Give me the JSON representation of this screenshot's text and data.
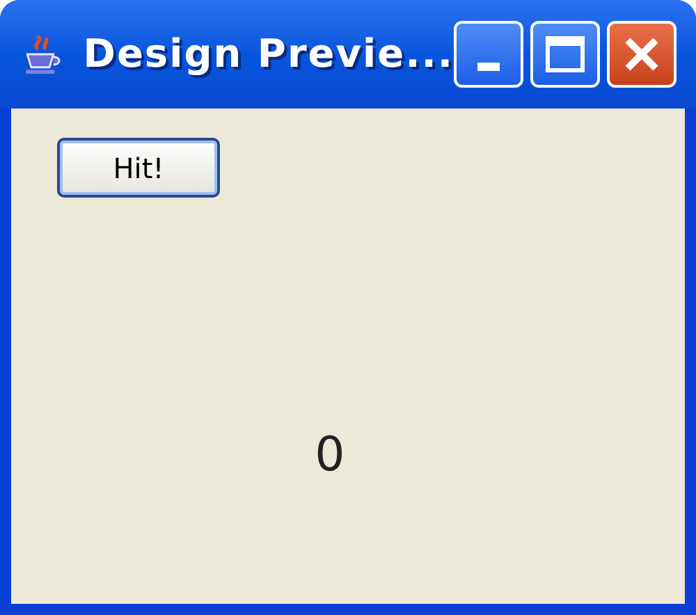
{
  "window": {
    "title": "Design Previe..."
  },
  "button": {
    "label": "Hit!"
  },
  "counter": {
    "value": "0"
  }
}
